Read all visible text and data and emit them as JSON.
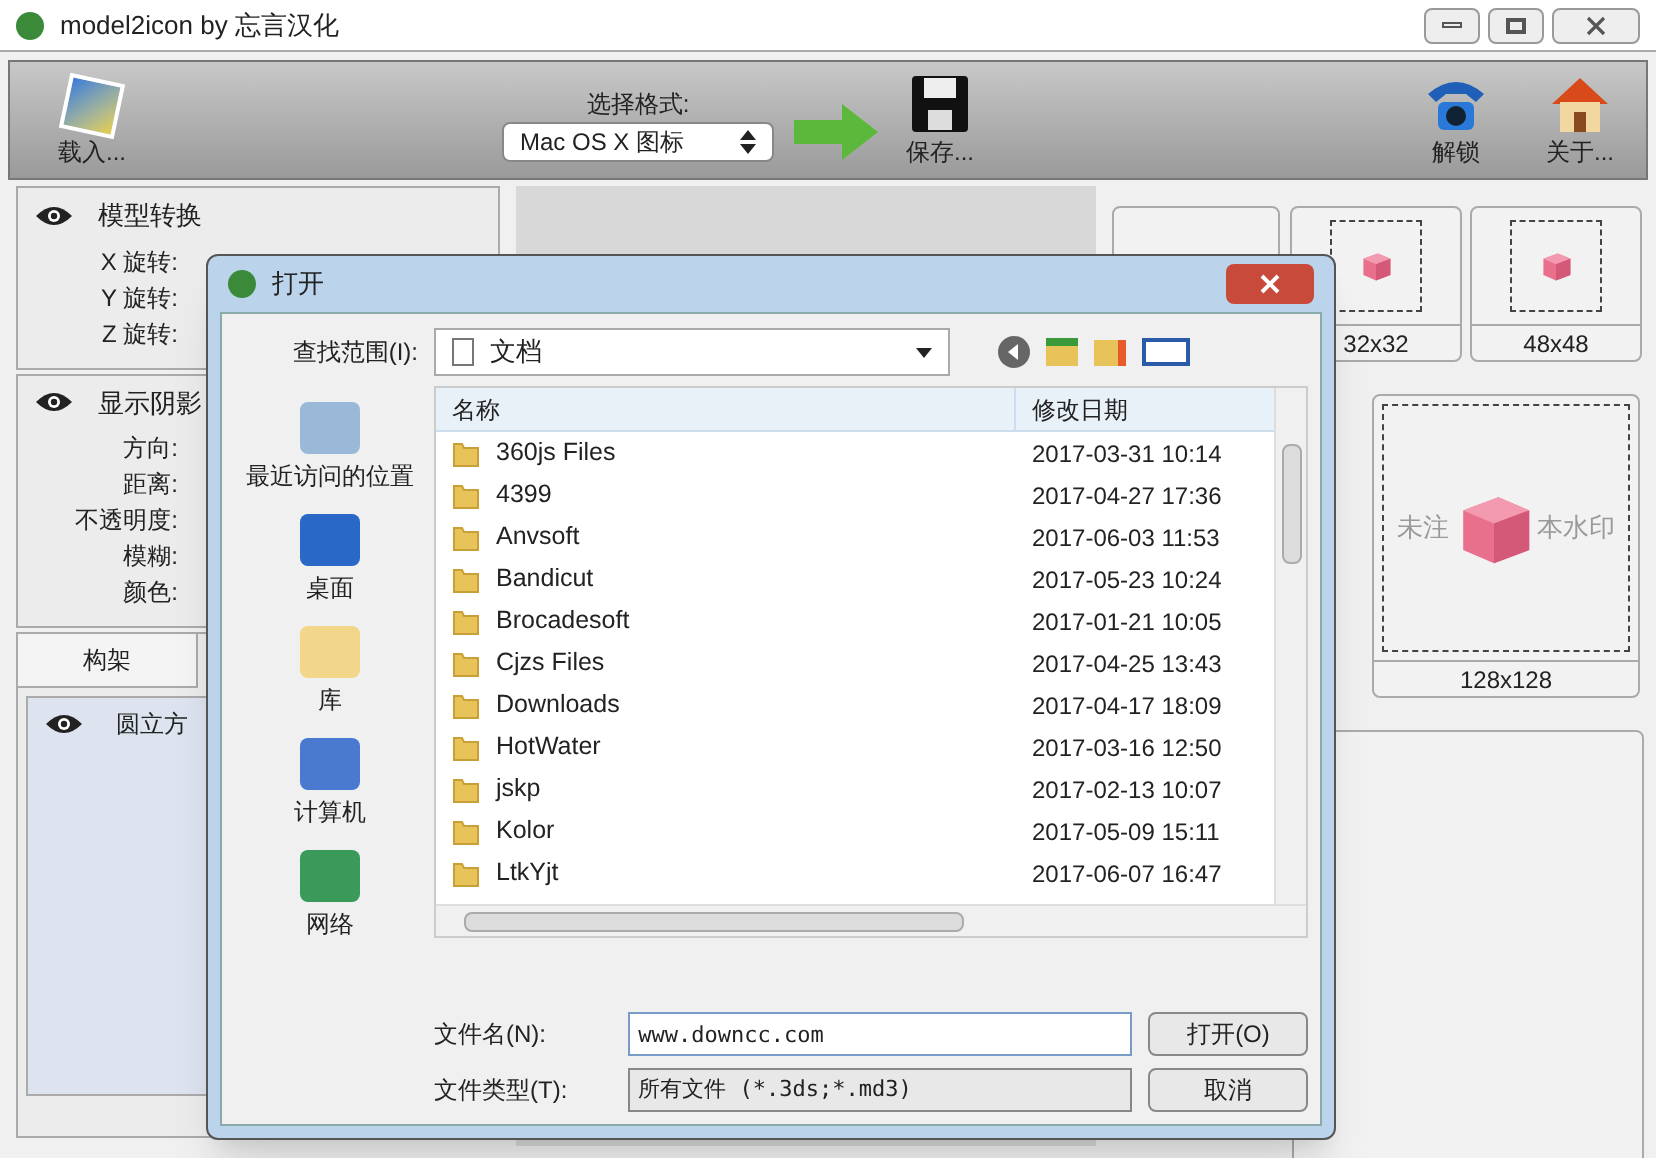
{
  "window": {
    "title": "model2icon by 忘言汉化"
  },
  "toolbar": {
    "load": "载入...",
    "format_label": "选择格式:",
    "format_value": "Mac OS X 图标",
    "save": "保存...",
    "unlock": "解锁",
    "about": "关于..."
  },
  "left_panel": {
    "sections": [
      {
        "title": "模型转换",
        "fields": [
          "X 旋转:",
          "Y 旋转:",
          "Z 旋转:"
        ]
      },
      {
        "title": "显示阴影",
        "fields": [
          "方向:",
          "距离:",
          "不透明度:",
          "模糊:",
          "颜色:"
        ]
      }
    ],
    "tab": "构架",
    "tree_items": [
      "圆立方"
    ]
  },
  "previews": [
    {
      "label": "32x32"
    },
    {
      "label": "48x48"
    }
  ],
  "large_preview": {
    "label": "128x128",
    "watermark_left": "未注",
    "watermark_right": "本水印"
  },
  "dialog": {
    "title": "打开",
    "look_in_label": "查找范围(I):",
    "look_in_value": "文档",
    "places": [
      "最近访问的位置",
      "桌面",
      "库",
      "计算机",
      "网络"
    ],
    "columns": [
      "名称",
      "修改日期"
    ],
    "rows": [
      {
        "name": "360js Files",
        "date": "2017-03-31 10:14"
      },
      {
        "name": "4399",
        "date": "2017-04-27 17:36"
      },
      {
        "name": "Anvsoft",
        "date": "2017-06-03 11:53"
      },
      {
        "name": "Bandicut",
        "date": "2017-05-23 10:24"
      },
      {
        "name": "Brocadesoft",
        "date": "2017-01-21 10:05"
      },
      {
        "name": "Cjzs Files",
        "date": "2017-04-25 13:43"
      },
      {
        "name": "Downloads",
        "date": "2017-04-17 18:09"
      },
      {
        "name": "HotWater",
        "date": "2017-03-16 12:50"
      },
      {
        "name": "jskp",
        "date": "2017-02-13 10:07"
      },
      {
        "name": "Kolor",
        "date": "2017-05-09 15:11"
      },
      {
        "name": "LtkYjt",
        "date": "2017-06-07 16:47"
      }
    ],
    "filename_label": "文件名(N):",
    "filename_value": "www.downcc.com",
    "filetype_label": "文件类型(T):",
    "filetype_value": "所有文件 (*.3ds;*.md3)",
    "buttons": [
      "打开(O)",
      "取消"
    ]
  }
}
